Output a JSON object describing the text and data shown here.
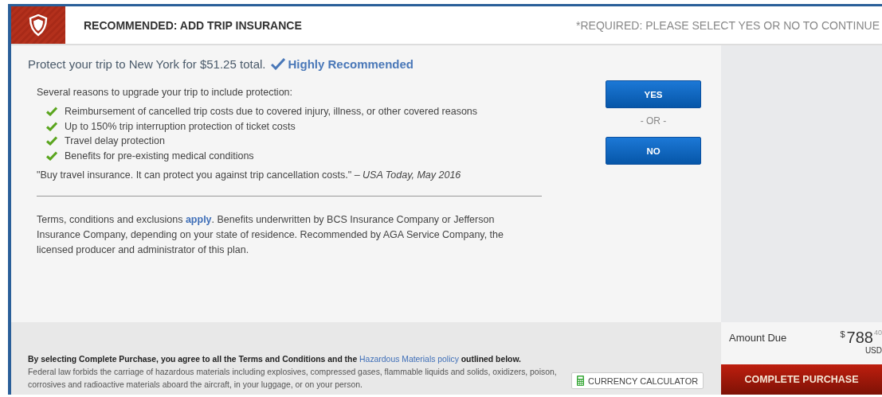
{
  "header": {
    "title": "RECOMMENDED: ADD TRIP INSURANCE",
    "required_note": "*REQUIRED: PLEASE SELECT YES OR NO TO CONTINUE"
  },
  "offer": {
    "headline": "Protect your trip to New York for $51.25 total.",
    "badge": "Highly Recommended",
    "intro": "Several reasons to upgrade your trip to include protection:",
    "benefits": [
      "Reimbursement of cancelled trip costs due to covered injury, illness, or other covered reasons",
      "Up to 150% trip interruption protection of ticket costs",
      "Travel delay protection",
      "Benefits for pre-existing medical conditions"
    ],
    "quote": "\"Buy travel insurance. It can protect you against trip cancellation costs.\" – *USA Today, May 2016*",
    "terms_before": "Terms, conditions and exclusions",
    "terms_link": "apply",
    "terms_after": ". Benefits underwritten by BCS Insurance Company or Jefferson Insurance Company, depending on your state of residence. Recommended by AGA Service Company, the licensed producer and administrator of this plan."
  },
  "choice": {
    "yes": "YES",
    "or": "- OR -",
    "no": "NO"
  },
  "footer": {
    "agree_before": "By selecting Complete Purchase, you agree to all the Terms and Conditions and the",
    "agree_link": "Hazardous Materials policy",
    "agree_after": "outlined below.",
    "notice": "Federal law forbids the carriage of hazardous materials including explosives, compressed gases, flammable liquids and solids, oxidizers, poison, corrosives and radioactive materials aboard the aircraft, in your luggage, or on your person.",
    "calculator": "CURRENCY CALCULATOR"
  },
  "summary": {
    "label": "Amount Due",
    "currency_symbol": "$",
    "amount": "788",
    "cents": "40",
    "currency": "USD",
    "purchase": "COMPLETE PURCHASE"
  }
}
